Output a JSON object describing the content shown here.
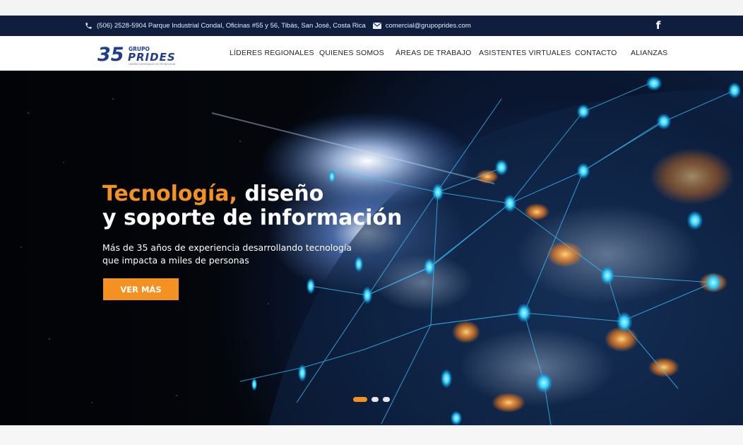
{
  "topbar": {
    "phone_icon": "phone-icon",
    "address": "(506) 2528-5904 Parque Industrial Condal, Oficinas #55 y 56, Tibás, San José, Costa Rica",
    "email_icon": "envelope-icon",
    "email": "comercial@grupoprides.com",
    "social_icon": "facebook-icon",
    "social_glyph": "f"
  },
  "logo": {
    "number": "35",
    "word_top": "GRUPO",
    "word_main": "PRIDES",
    "tagline": "LÍDERES REGIONALES EN TECNOLOGÍA"
  },
  "nav": {
    "items": [
      {
        "label": "LÍDERES REGIONALES"
      },
      {
        "label": "QUIENES SOMOS"
      },
      {
        "label": "ÁREAS DE TRABAJO"
      },
      {
        "label": "ASISTENTES VIRTUALES"
      },
      {
        "label": "CONTACTO"
      },
      {
        "label": "ALIANZAS"
      }
    ]
  },
  "hero": {
    "title_accent": "Tecnología,",
    "title_rest": " diseño",
    "title_line2": "y soporte de información",
    "subtitle_line1": "Más de 35 años de experiencia desarrollando tecnología",
    "subtitle_line2": "que impacta a miles de personas",
    "cta_label": "VER MÁS",
    "slides": {
      "total": 3,
      "active": 1
    }
  },
  "colors": {
    "accent": "#f39122",
    "topbar_bg": "#0f1d3f",
    "brand_blue": "#1f3d8f"
  }
}
